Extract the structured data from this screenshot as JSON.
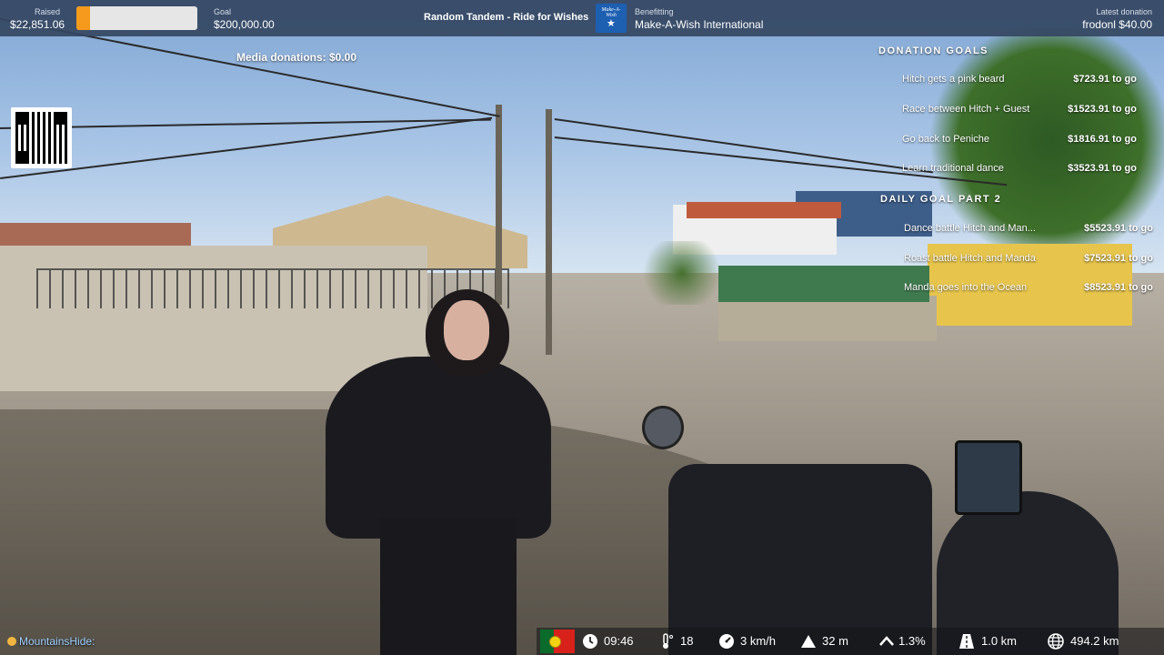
{
  "topbar": {
    "raised_label": "Raised",
    "raised_value": "$22,851.06",
    "progress_fraction": 0.114,
    "goal_label": "Goal",
    "goal_value": "$200,000.00",
    "campaign_title": "Random Tandem - Ride for Wishes",
    "logo_text": "Make-A-Wish",
    "benefitting_label": "Benefitting",
    "benefitting_value": "Make-A-Wish International",
    "latest_label": "Latest donation",
    "latest_value": "frodonl $40.00"
  },
  "media_donations": "Media donations: $0.00",
  "goals": {
    "heading": "DONATION GOALS",
    "items": [
      {
        "name": "Hitch gets a pink beard",
        "amount": "$723.91 to go"
      },
      {
        "name": "Race between Hitch + Guest",
        "amount": "$1523.91 to go"
      },
      {
        "name": "Go back to Peniche",
        "amount": "$1816.91 to go"
      },
      {
        "name": "Learn traditional dance",
        "amount": "$3523.91 to go"
      }
    ],
    "daily_heading": "DAILY GOAL PART 2",
    "daily_items": [
      {
        "name": "Dance battle Hitch and Man...",
        "amount": "$5523.91 to go"
      },
      {
        "name": "Roast battle Hitch and Manda",
        "amount": "$7523.91 to go"
      },
      {
        "name": "Manda goes into the Ocean",
        "amount": "$8523.91 to go"
      }
    ]
  },
  "bottombar": {
    "username": "MountainsHide:",
    "time": "09:46",
    "temperature": "18",
    "speed": "3 km/h",
    "altitude": "32 m",
    "grade": "1.3%",
    "distance_day": "1.0 km",
    "distance_total": "494.2 km"
  },
  "colors": {
    "topbar_bg": "#344662",
    "progress_fill": "#f59a1c",
    "username": "#9fd0ff",
    "flag_green": "#0a6b2a",
    "flag_red": "#d8211b"
  }
}
